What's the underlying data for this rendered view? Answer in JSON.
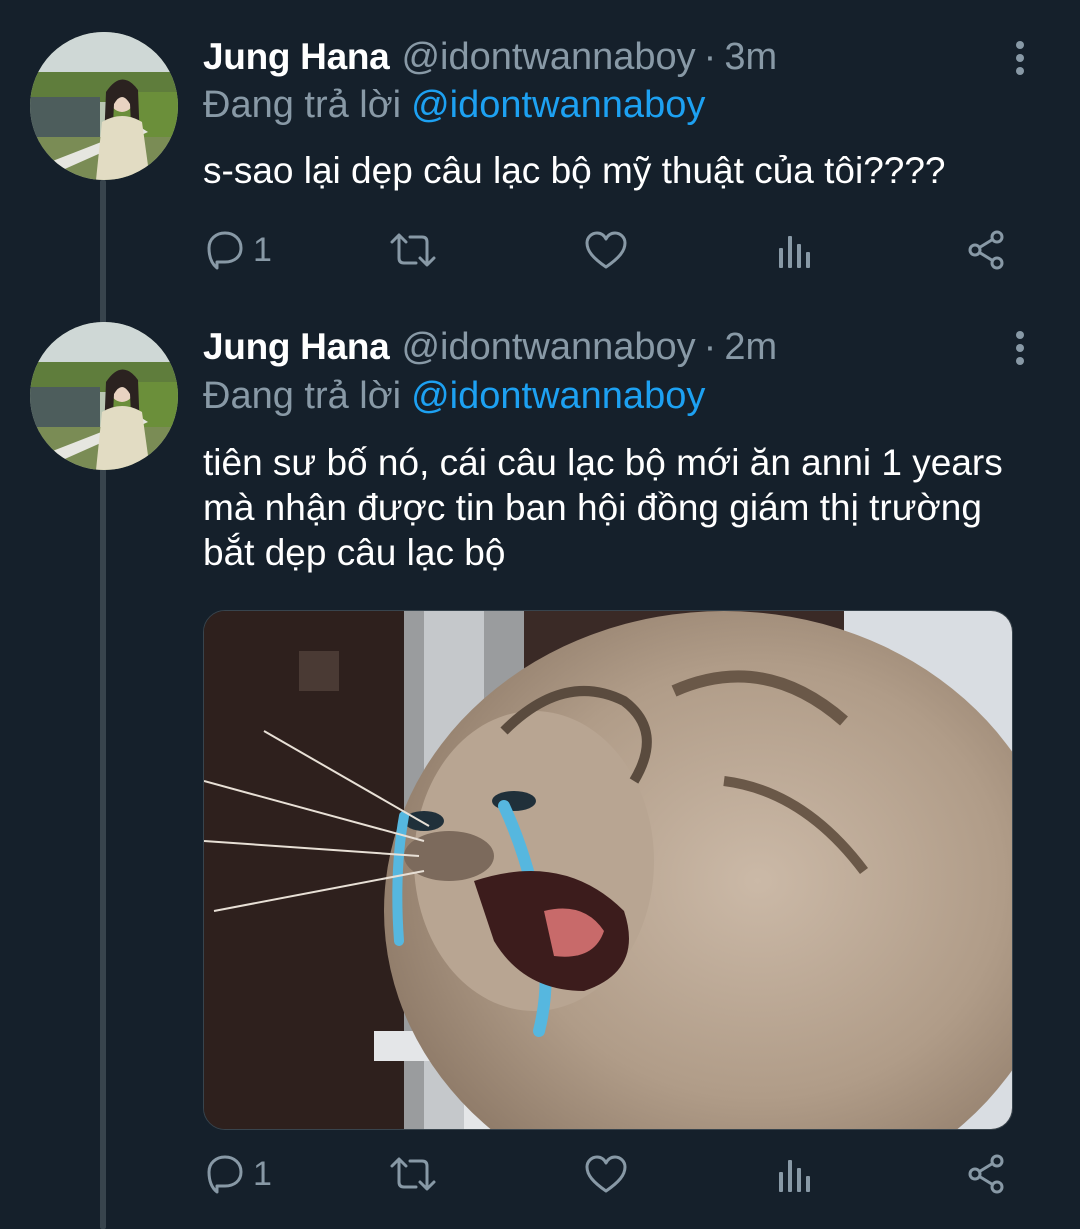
{
  "tweets": [
    {
      "name": "Jung Hana",
      "handle": "@idontwannaboy",
      "separator": "·",
      "time": "3m",
      "reply_prefix": "Đang trả lời",
      "reply_mention": "@idontwannaboy",
      "text": "s-sao lại dẹp câu lạc bộ mỹ thuật của tôi????",
      "reply_count": "1"
    },
    {
      "name": "Jung Hana",
      "handle": "@idontwannaboy",
      "separator": "·",
      "time": "2m",
      "reply_prefix": "Đang trả lời",
      "reply_mention": "@idontwannaboy",
      "text": "tiên sư bố nó, cái câu lạc bộ mới ăn anni 1 years mà nhận được tin ban hội đồng giám thị trường bắt dẹp câu lạc bộ",
      "reply_count": "1"
    }
  ],
  "icons": {
    "reply": "speech-bubble-icon",
    "retweet": "retweet-icon",
    "like": "heart-icon",
    "analytics": "bar-chart-icon",
    "share": "share-icon",
    "more": "vertical-ellipsis-icon"
  },
  "colors": {
    "background": "#15202b",
    "primary_text": "#ffffff",
    "secondary_text": "#8899a6",
    "link": "#1da1f2",
    "thread_line": "#38444d"
  }
}
